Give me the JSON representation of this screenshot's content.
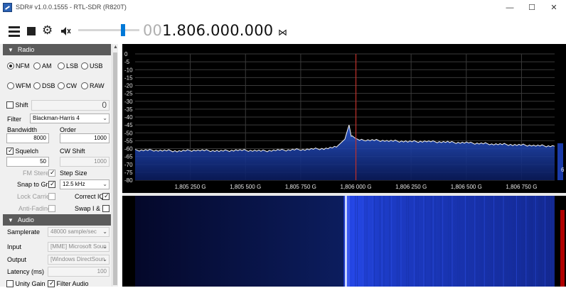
{
  "window": {
    "title": "SDR# v1.0.0.1555 - RTL-SDR (R820T)",
    "minimize": "—",
    "maximize": "☐",
    "close": "✕"
  },
  "toolbar": {
    "menu_icon": "hamburger-menu-icon",
    "stop_icon": "stop-icon",
    "settings_icon": "gear-icon",
    "mute_icon": "speaker-muted-icon",
    "volume_level": 0.7,
    "frequency_leading": "00",
    "frequency_main": "1.806.000.000",
    "tuning_icon": "bowtie-icon"
  },
  "radio": {
    "header": "Radio",
    "modes_row1": [
      "NFM",
      "AM",
      "LSB",
      "USB"
    ],
    "modes_row2": [
      "WFM",
      "DSB",
      "CW",
      "RAW"
    ],
    "selected_mode": "NFM",
    "shift_label": "Shift",
    "shift_value": "0",
    "filter_label": "Filter",
    "filter_value": "Blackman-Harris 4",
    "bandwidth_label": "Bandwidth",
    "bandwidth_value": "8000",
    "order_label": "Order",
    "order_value": "1000",
    "squelch_label": "Squelch",
    "squelch_value": "50",
    "cw_shift_label": "CW Shift",
    "cw_shift_value": "1000",
    "fm_stereo_label": "FM Stereo",
    "step_size_label": "Step Size",
    "snap_label": "Snap to Grid",
    "step_value": "12.5 kHz",
    "lock_carrier_label": "Lock Carrier",
    "correct_iq_label": "Correct IQ",
    "anti_fading_label": "Anti-Fading",
    "swap_iq_label": "Swap I & Q"
  },
  "audio": {
    "header": "Audio",
    "samplerate_label": "Samplerate",
    "samplerate_value": "48000 sample/sec",
    "input_label": "Input",
    "input_value": "[MME] Microsoft Soun",
    "output_label": "Output",
    "output_value": "[Windows DirectSoun",
    "latency_label": "Latency (ms)",
    "latency_value": "100",
    "unity_gain_label": "Unity Gain",
    "filter_audio_label": "Filter Audio"
  },
  "chart_data": {
    "type": "line",
    "title": "",
    "xlabel": "",
    "ylabel": "",
    "y_ticks": [
      "0",
      "-5",
      "-10",
      "-15",
      "-20",
      "-25",
      "-30",
      "-35",
      "-40",
      "-45",
      "-50",
      "-55",
      "-60",
      "-65",
      "-70",
      "-75",
      "-80"
    ],
    "x_ticks": [
      "1,805 250 G",
      "1,805 500 G",
      "1,805 750 G",
      "1,806 000 G",
      "1,806 250 G",
      "1,806 500 G",
      "1,806 750 G"
    ],
    "ylim": [
      -80,
      0
    ],
    "grid": true,
    "center_frequency": "1,806 000 G",
    "x": [
      0,
      0.05,
      0.1,
      0.15,
      0.2,
      0.25,
      0.3,
      0.35,
      0.4,
      0.45,
      0.48,
      0.5,
      0.51,
      0.515,
      0.52,
      0.53,
      0.55,
      0.6,
      0.65,
      0.7,
      0.75,
      0.8,
      0.85,
      0.9,
      0.95,
      1.0
    ],
    "values": [
      -61,
      -61,
      -61.5,
      -61,
      -61.5,
      -61,
      -61.5,
      -61,
      -60.5,
      -60,
      -59,
      -54,
      -45,
      -52,
      -53,
      -54,
      -54.5,
      -55,
      -55.5,
      -55.5,
      -56,
      -56.5,
      -57,
      -57.5,
      -58,
      -58.5
    ],
    "side_label": "6"
  }
}
